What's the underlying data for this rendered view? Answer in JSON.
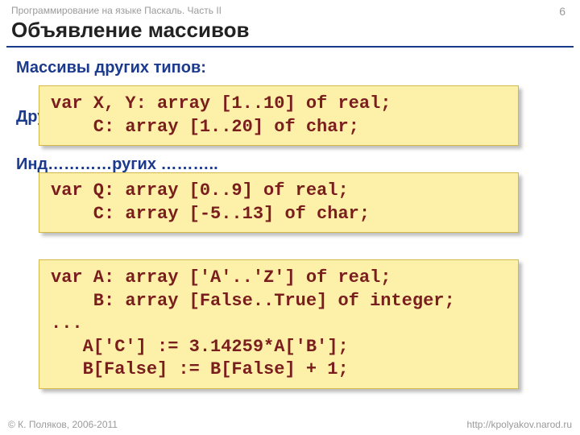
{
  "header": {
    "breadcrumb": "Программирование на языке Паскаль. Часть II",
    "page_number": "6",
    "title": "Объявление массивов"
  },
  "sections": {
    "types_heading": "Массивы других типов:",
    "range_heading": "Другой диапазон индексов:",
    "indices_heading_truncated": "Инд…………ругих ……….."
  },
  "code": {
    "block1": "var X, Y: array [1..10] of real;\n    C: array [1..20] of char;",
    "block2": "var Q: array [0..9] of real;\n    C: array [-5..13] of char;",
    "block3": "var A: array ['A'..'Z'] of real;\n    B: array [False..True] of integer;\n...\n   A['C'] := 3.14259*A['B'];\n   B[False] := B[False] + 1;"
  },
  "footer": {
    "left": "© К. Поляков, 2006-2011",
    "right": "http://kpolyakov.narod.ru"
  }
}
